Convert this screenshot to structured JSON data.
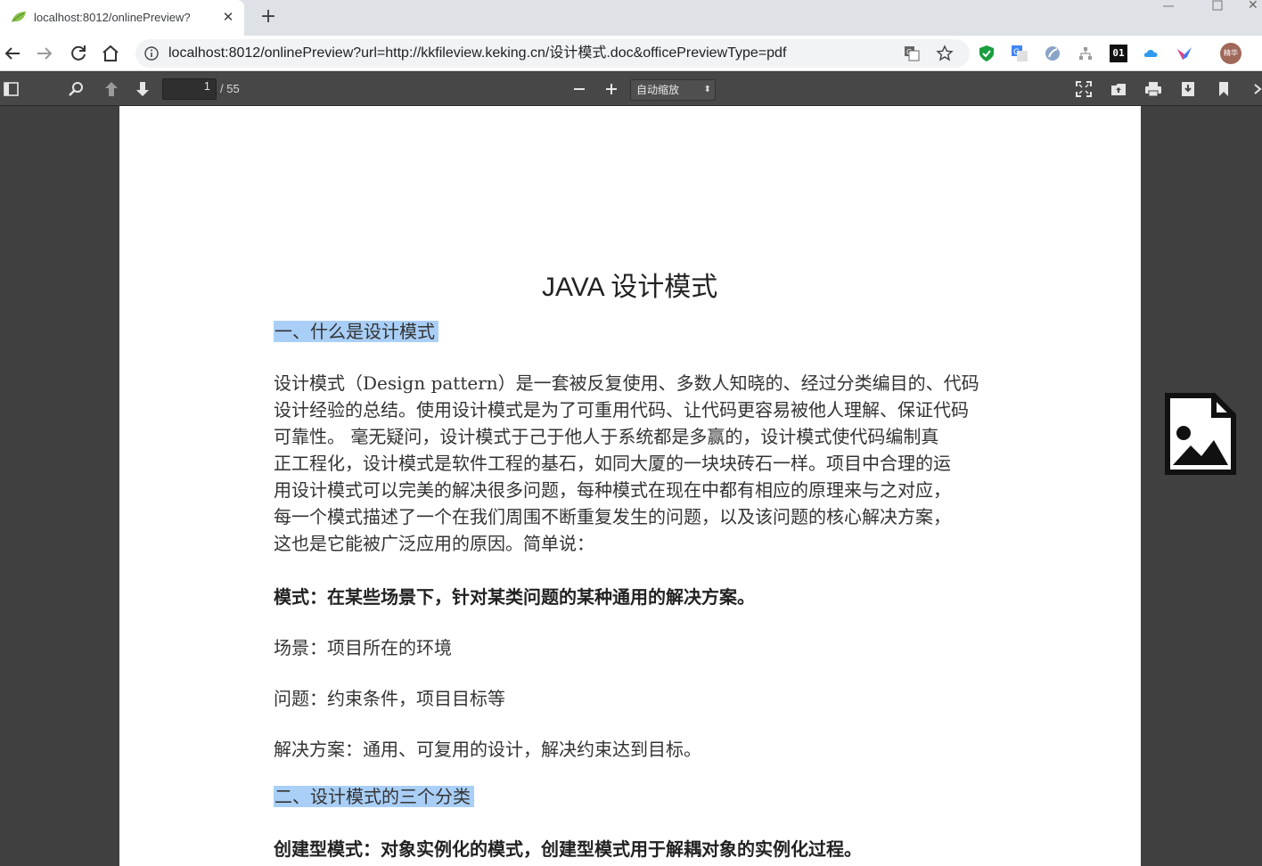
{
  "browser": {
    "tab": {
      "title": "localhost:8012/onlinePreview?"
    },
    "address_bar": {
      "url": "localhost:8012/onlinePreview?url=http://kkfileview.keking.cn/设计模式.doc&officePreviewType=pdf"
    },
    "avatar_label": "精华",
    "extension_01_label": "01"
  },
  "pdf_toolbar": {
    "page_number": "1",
    "page_count": "/ 55",
    "zoom": "自动缩放"
  },
  "document": {
    "title": "JAVA 设计模式",
    "heading_1": "一、什么是设计模式",
    "paragraph_lines": [
      "设计模式（Design pattern）是一套被反复使用、多数人知晓的、经过分类编目的、代码",
      "设计经验的总结。使用设计模式是为了可重用代码、让代码更容易被他人理解、保证代码",
      "可靠性。 毫无疑问，设计模式于己于他人于系统都是多赢的，设计模式使代码编制真",
      "正工程化，设计模式是软件工程的基石，如同大厦的一块块砖石一样。项目中合理的运",
      "用设计模式可以完美的解决很多问题，每种模式在现在中都有相应的原理来与之对应，",
      "每一个模式描述了一个在我们周围不断重复发生的问题，以及该问题的核心解决方案，",
      "这也是它能被广泛应用的原因。简单说："
    ],
    "pattern_definition": "模式：在某些场景下，针对某类问题的某种通用的解决方案。",
    "scene": "场景：项目所在的环境",
    "problem": "问题：约束条件，项目目标等",
    "solution": "解决方案：通用、可复用的设计，解决约束达到目标。",
    "heading_2": "二、设计模式的三个分类",
    "creational": "创建型模式：对象实例化的模式，创建型模式用于解耦对象的实例化过程。"
  },
  "colors": {
    "highlight": "#a9cff7",
    "pdf_toolbar": "#474747",
    "viewer_background": "#404040"
  }
}
